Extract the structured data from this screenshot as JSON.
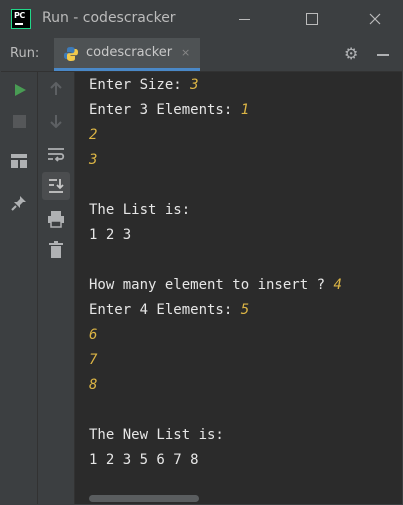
{
  "window": {
    "title": "Run - codescracker"
  },
  "run_toolbar": {
    "label": "Run:",
    "tab_label": "codescracker",
    "tab_close": "×"
  },
  "console": {
    "lines": [
      {
        "text": "Enter Size: ",
        "input": "3"
      },
      {
        "text": "Enter 3 Elements: ",
        "input": "1"
      },
      {
        "text": "",
        "input": "2"
      },
      {
        "text": "",
        "input": "3"
      },
      {
        "text": "",
        "input": ""
      },
      {
        "text": "The List is:",
        "input": ""
      },
      {
        "text": "1 2 3",
        "input": ""
      },
      {
        "text": "",
        "input": ""
      },
      {
        "text": "How many element to insert ? ",
        "input": "4"
      },
      {
        "text": "Enter 4 Elements: ",
        "input": "5"
      },
      {
        "text": "",
        "input": "6"
      },
      {
        "text": "",
        "input": "7"
      },
      {
        "text": "",
        "input": "8"
      },
      {
        "text": "",
        "input": ""
      },
      {
        "text": "The New List is:",
        "input": ""
      },
      {
        "text": "1 2 3 5 6 7 8",
        "input": ""
      }
    ]
  },
  "colors": {
    "input_text": "#dcb545",
    "run_green": "#499c54",
    "tab_underline": "#4a88c7"
  }
}
